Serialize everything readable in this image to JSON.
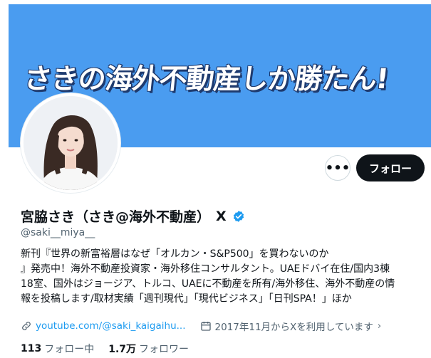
{
  "banner": {
    "text": "さきの海外不動産しか勝たん!",
    "bg_color": "#4a9cf0"
  },
  "profile": {
    "display_name": "宮脇さき（さき@海外不動産）",
    "x_mark": "X",
    "handle": "@saki__miya__",
    "verified": true,
    "verified_color": "#1d9bf0"
  },
  "actions": {
    "more_icon": "more-horizontal-icon",
    "more_label": "•••",
    "follow_label": "フォロー"
  },
  "bio": {
    "lines": [
      "新刊『世界の新富裕層はなぜ「オルカン・S&P500」を買わないのか",
      "』発売中！海外不動産投資家・海外移住コンサルタント。UAEドバイ在住/国内3棟",
      "18室、国外はジョージア、トルコ、UAEに不動産を所有/海外移住、海外不動産の情",
      "報を投稿します/取材実績「週刊現代」「現代ビジネス」「日刊SPA！」ほか"
    ]
  },
  "meta": {
    "link_icon": "link-icon",
    "link_text": "youtube.com/@saki_kaigaihu...",
    "calendar_icon": "calendar-icon",
    "joined_text": "2017年11月からXを利用しています",
    "chevron": "›"
  },
  "stats": {
    "following_count": "113",
    "following_label": "フォロー中",
    "followers_count": "1.7万",
    "followers_label": "フォロワー"
  },
  "colors": {
    "accent": "#1d9bf0",
    "text": "#0f1419",
    "secondary": "#536471"
  }
}
